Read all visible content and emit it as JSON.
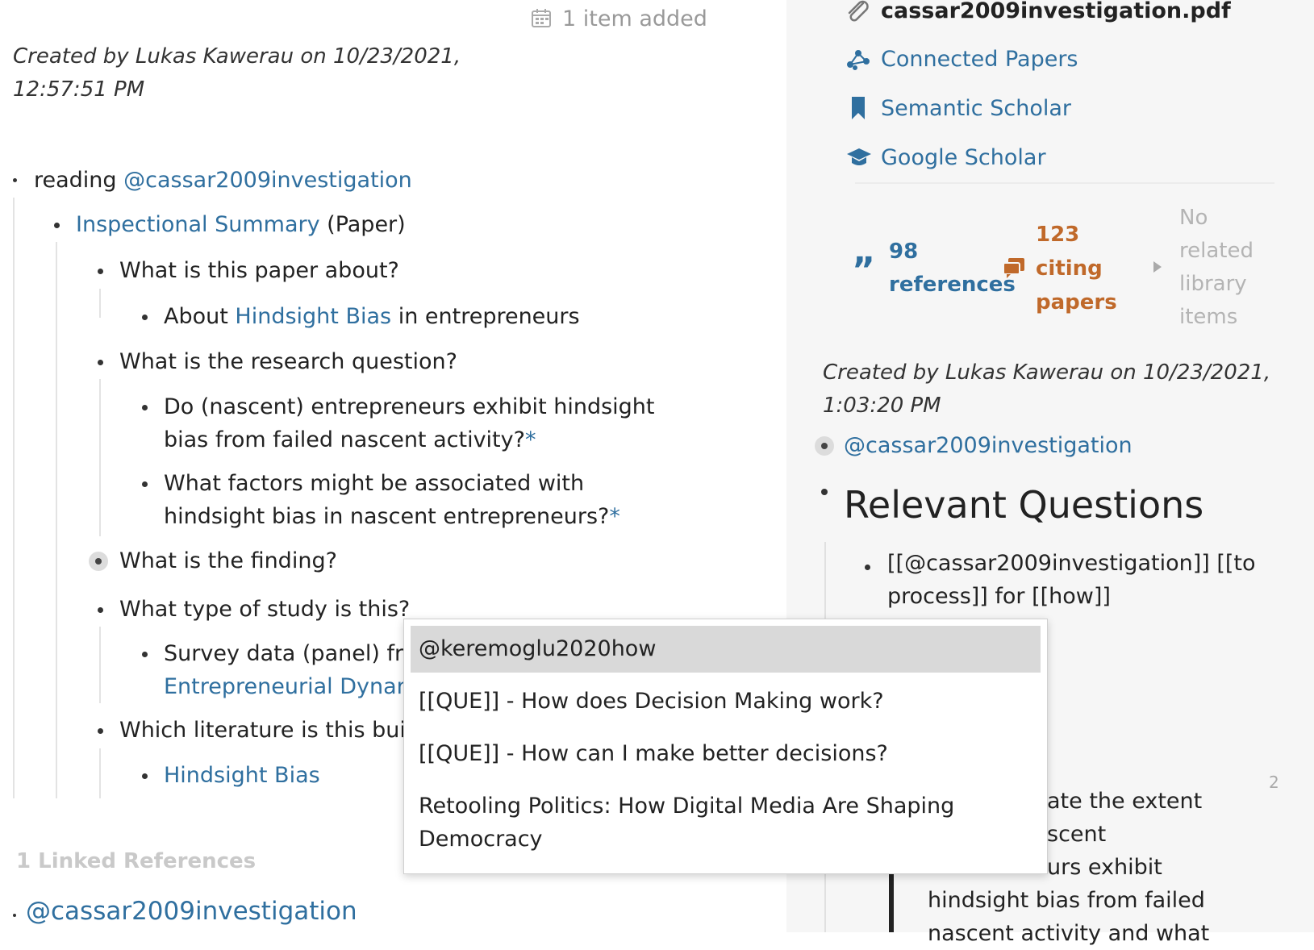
{
  "left": {
    "items_added": "1 item added",
    "created_by": "Created by Lukas Kawerau on 10/23/2021,",
    "created_time": "12:57:51 PM",
    "reading_prefix": "reading ",
    "reading_link": "@cassar2009investigation",
    "inspectional_link": "Inspectional Summary",
    "inspectional_suffix": " (Paper)",
    "q1": "What is this paper about?",
    "q1_a_prefix": "About ",
    "q1_a_link": "Hindsight Bias",
    "q1_a_suffix": " in entrepreneurs",
    "q2": "What is the research question?",
    "q2_a1_line1": "Do (nascent) entrepreneurs exhibit hindsight",
    "q2_a1_line2": "bias from failed nascent activity?",
    "q2_a2_line1": "What factors might be associated with",
    "q2_a2_line2": "hindsight bias in nascent entrepreneurs?",
    "asterisk": "*",
    "q3": "What is the finding?",
    "q4": "What type of study is this?",
    "q4_a_line1": "Survey data (panel) fro",
    "q4_a_line2_link": "Entrepreneurial Dynam",
    "q5": "Which literature is this buil",
    "q5_a_link": "Hindsight Bias",
    "linked_refs": "1 Linked References",
    "linked_ref_item": "@cassar2009investigation"
  },
  "right": {
    "pdf_name": "cassar2009investigation.pdf",
    "connected_papers": "Connected Papers",
    "semantic_scholar": "Semantic Scholar",
    "google_scholar": "Google Scholar",
    "ref_count": "98",
    "ref_label": "references",
    "cite_count": "123",
    "cite_label1": "citing",
    "cite_label2": "papers",
    "related_1": "No",
    "related_2": "related",
    "related_3": "library",
    "related_4": "items",
    "created_by": "Created by Lukas Kawerau on 10/23/2021,",
    "created_time": "1:03:20 PM",
    "tag_link": "@cassar2009investigation",
    "heading": "Relevant Questions",
    "edit_line1": "[[@cassar2009investigation]] [[to",
    "edit_line2": "process]] for [[how]]",
    "count_badge": "2",
    "quote_line1": "ate the extent",
    "quote_line2": "scent",
    "quote_line3": "urs exhibit",
    "quote_line4": "hindsight bias from failed",
    "quote_line5": "nascent activity and what"
  },
  "dropdown": {
    "items": [
      "@keremoglu2020how",
      "[[QUE]] - How does Decision Making work?",
      "[[QUE]] - How can I make better decisions?",
      "Retooling Politics: How Digital Media Are Shaping",
      "Democracy"
    ]
  },
  "colors": {
    "link": "#2f6f9f",
    "citing": "#c0692a",
    "references": "#2f6f9f",
    "selected": "#d9d9d9"
  }
}
